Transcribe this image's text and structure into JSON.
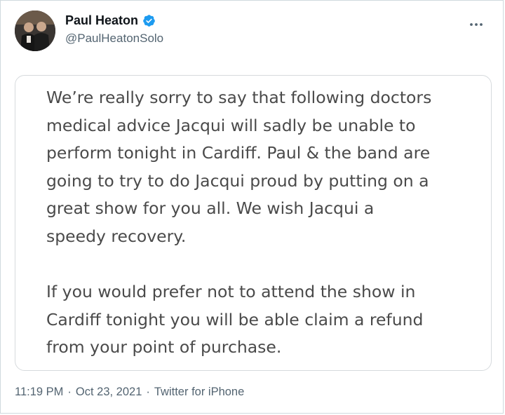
{
  "tweet": {
    "author": {
      "name": "Paul Heaton",
      "handle": "@PaulHeatonSolo"
    },
    "statement": {
      "paragraph_1": "We’re really sorry to say that following doctors\nmedical advice Jacqui will sadly be unable to\nperform tonight in Cardiff. Paul & the band are\ngoing to try to do Jacqui proud by putting on a\ngreat show for you all. We wish Jacqui a\nspeedy recovery.",
      "paragraph_2": "If you would prefer not to attend the show in\nCardiff tonight you will be able claim a refund\nfrom your point of purchase."
    },
    "footer": {
      "time": "11:19 PM",
      "separator": "·",
      "date": "Oct 23, 2021",
      "source": "Twitter for iPhone"
    }
  },
  "colors": {
    "verified_badge": "#1d9bf0",
    "secondary_text": "#536471",
    "statement_text": "#4a4a4a"
  },
  "icons": {
    "verified": "verified-badge-icon",
    "more": "more-options-icon"
  }
}
